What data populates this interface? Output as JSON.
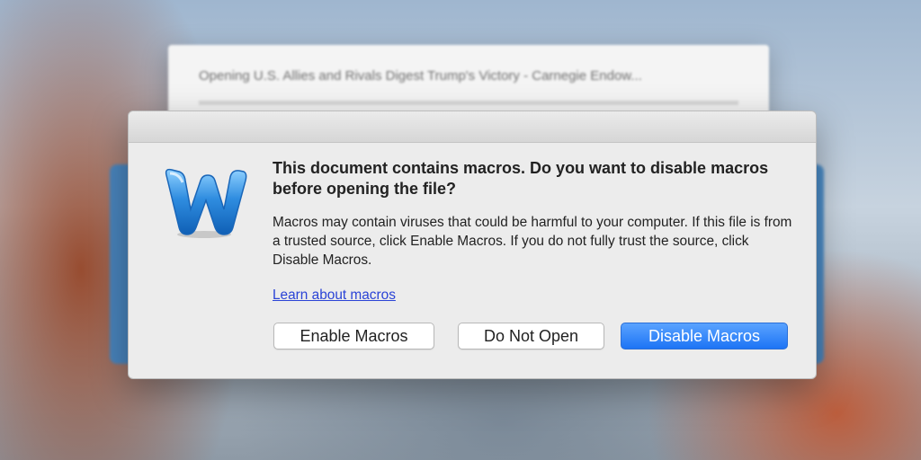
{
  "background_window": {
    "title": "Opening U.S. Allies and Rivals Digest Trump's Victory - Carnegie Endow..."
  },
  "dialog": {
    "icon": "word-app-icon",
    "heading": "This document contains macros. Do you want to disable macros before opening the file?",
    "body": "Macros may contain viruses that could be harmful to your computer.  If this file is from a trusted source, click Enable Macros. If you do not fully trust the source, click Disable Macros.",
    "link": "Learn about macros",
    "buttons": {
      "enable": "Enable Macros",
      "do_not_open": "Do Not Open",
      "disable": "Disable Macros"
    }
  },
  "colors": {
    "accent": "#1d74f5",
    "link": "#2a43d6",
    "word_blue": "#2f8de0"
  }
}
